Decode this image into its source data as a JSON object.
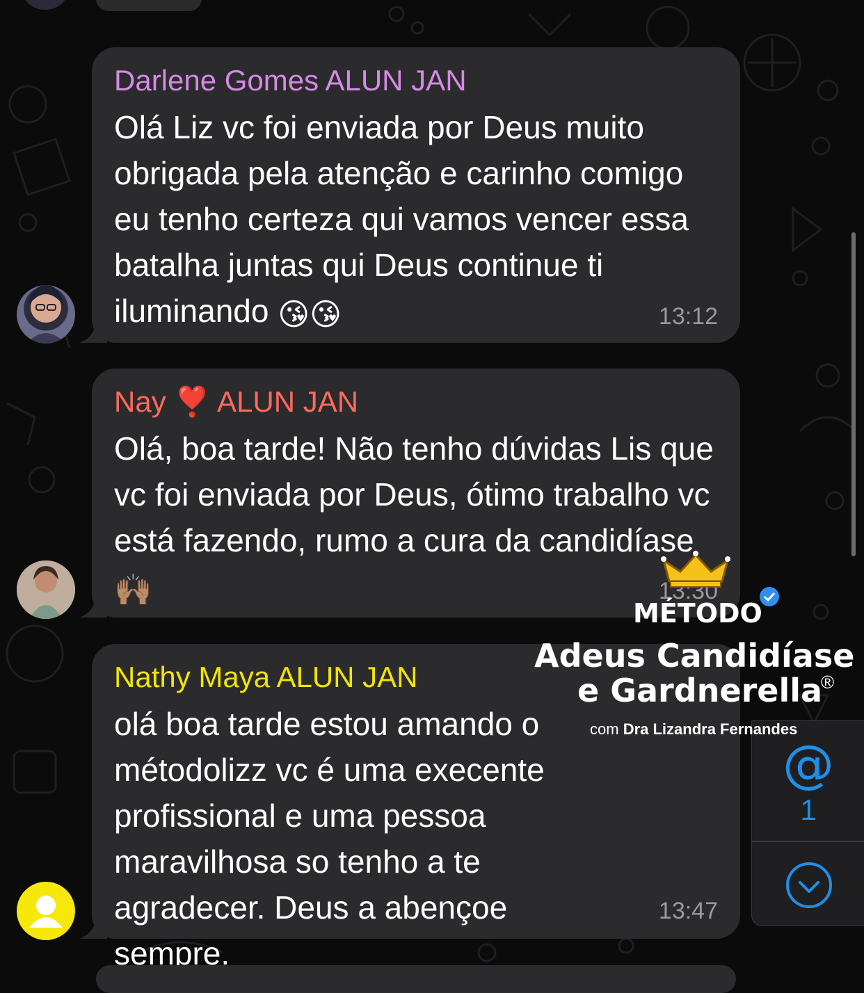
{
  "colors": {
    "background": "#0b0b0c",
    "bubble": "#2b2b2d",
    "accent_blue": "#1e90e8",
    "sender_darlene": "#d58ae6",
    "sender_nay": "#ff6a5c",
    "sender_nathy": "#f2e500",
    "timestamp": "#9a9a9e"
  },
  "messages": [
    {
      "sender": "Darlene Gomes ALUN JAN",
      "text": "Olá Liz vc foi enviada por Deus muito obrigada pela atenção e carinho comigo eu tenho certeza qui vamos vencer essa batalha juntas qui Deus continue ti iluminando",
      "emoji": "😘😘",
      "time": "13:12"
    },
    {
      "sender_name": "Nay",
      "sender_emoji": "❣️",
      "sender_suffix": "ALUN JAN",
      "text": "Olá, boa tarde! Não tenho dúvidas Lis que vc foi enviada por Deus, ótimo trabalho vc está fazendo, rumo a cura da candidíase",
      "emoji": "🙌🏽",
      "time": "13:30"
    },
    {
      "sender": "Nathy Maya ALUN JAN",
      "text": "olá boa tarde estou amando o métodolizz vc é uma execente profissional e uma pessoa maravilhosa so tenho a te agradecer. Deus a abençoe sempre.",
      "time": "13:47"
    }
  ],
  "mentions": {
    "icon": "at-icon",
    "symbol": "@",
    "count": "1"
  },
  "scroll_down": {
    "icon": "chevron-down-icon"
  },
  "watermark": {
    "line1": "MÉTODO",
    "line2": "Adeus Candidíase",
    "line3": "e Gardnerella",
    "registered": "®",
    "byline_prefix": "com",
    "byline_name": "Dra Lizandra Fernandes"
  }
}
